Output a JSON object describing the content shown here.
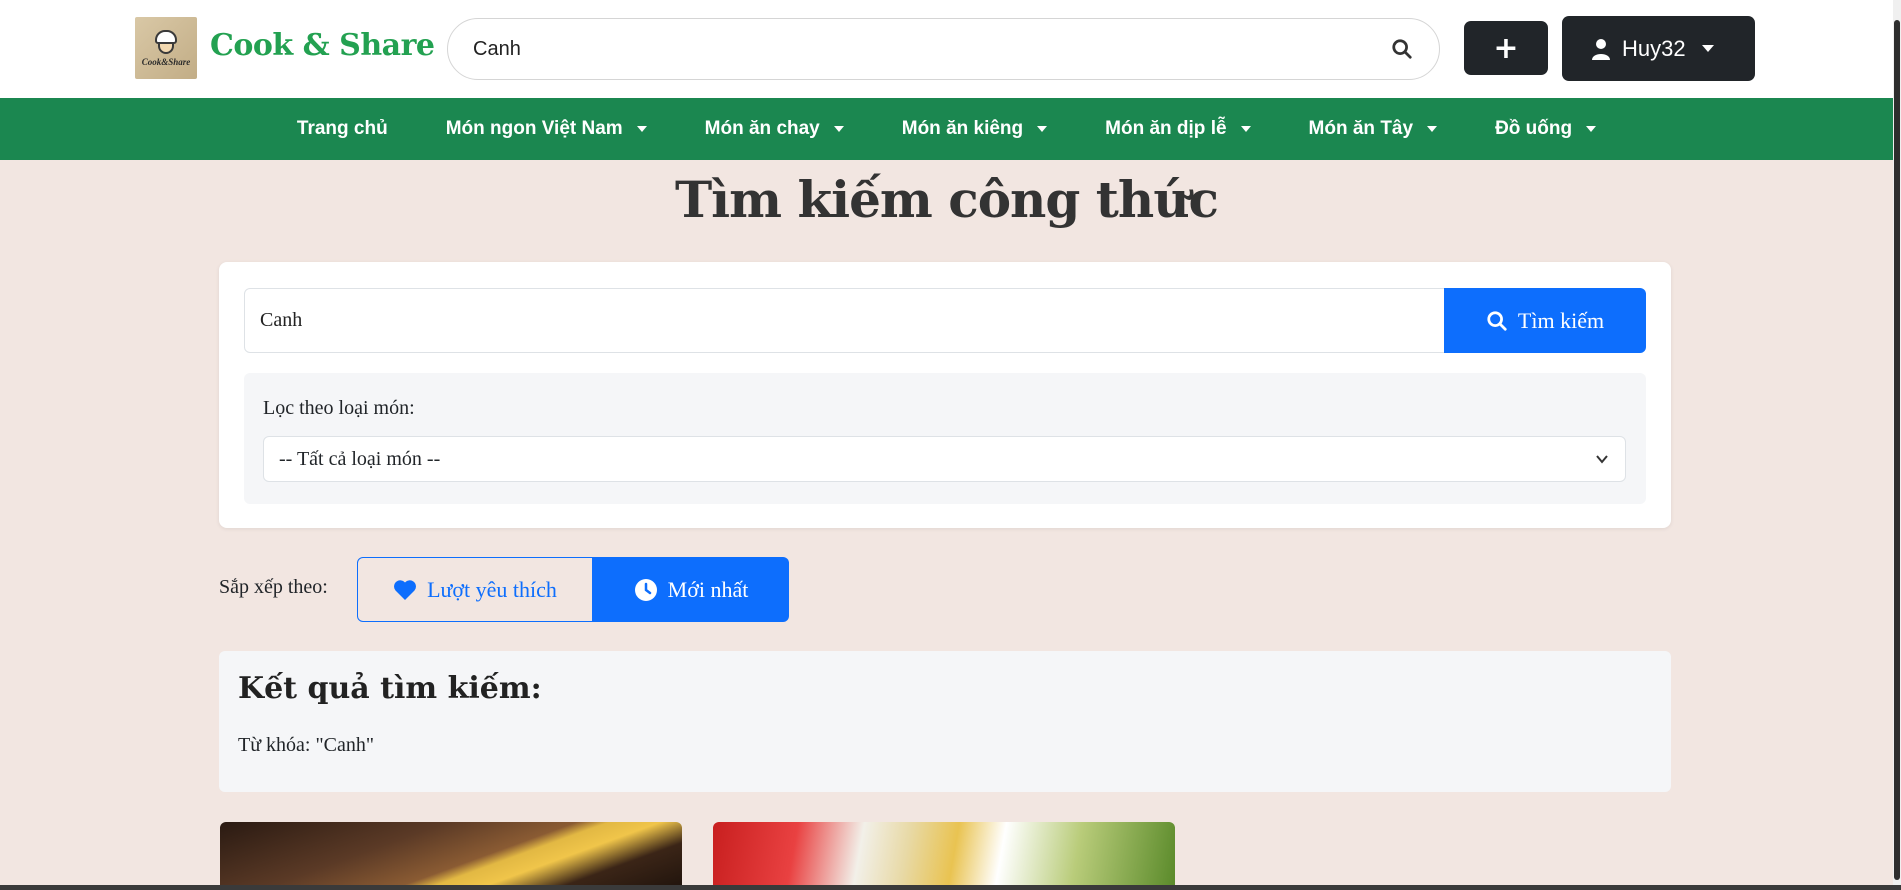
{
  "header": {
    "logo_text": "Cook&Share",
    "brand": "Cook & Share",
    "search_value": "Canh",
    "add_label": "+",
    "user_name": "Huy32"
  },
  "nav": {
    "items": [
      {
        "label": "Trang chủ",
        "dropdown": false
      },
      {
        "label": "Món ngon Việt Nam",
        "dropdown": true
      },
      {
        "label": "Món ăn chay",
        "dropdown": true
      },
      {
        "label": "Món ăn kiêng",
        "dropdown": true
      },
      {
        "label": "Món ăn dịp lễ",
        "dropdown": true
      },
      {
        "label": "Món ăn Tây",
        "dropdown": true
      },
      {
        "label": "Đồ uống",
        "dropdown": true
      }
    ]
  },
  "main": {
    "title": "Tìm kiếm công thức",
    "search_value": "Canh",
    "search_button": "Tìm kiếm",
    "filter_label": "Lọc theo loại món:",
    "filter_selected": "-- Tất cả loại món --",
    "sort_label": "Sắp xếp theo:",
    "sort_like": "Lượt yêu thích",
    "sort_newest": "Mới nhất",
    "results_title": "Kết quả tìm kiếm:",
    "results_keyword": "Từ khóa: \"Canh\""
  },
  "colors": {
    "brand_green": "#23a151",
    "nav_green": "#1b8750",
    "primary_blue": "#0d6efd",
    "dark": "#212529",
    "page_bg": "#f2e6e1"
  }
}
